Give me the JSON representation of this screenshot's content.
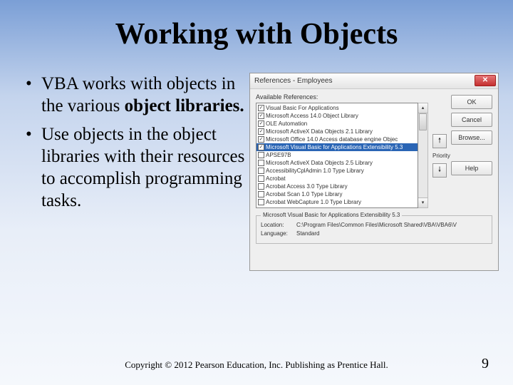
{
  "title": "Working with Objects",
  "bullets": [
    {
      "pre": "VBA works with objects in the various ",
      "bold": "object libraries."
    },
    {
      "pre": "Use objects in the object libraries with their resources to accomplish programming tasks.",
      "bold": ""
    }
  ],
  "dialog": {
    "title": "References - Employees",
    "available_label": "Available References:",
    "items": [
      {
        "checked": true,
        "label": "Visual Basic For Applications"
      },
      {
        "checked": true,
        "label": "Microsoft Access 14.0 Object Library"
      },
      {
        "checked": true,
        "label": "OLE Automation"
      },
      {
        "checked": true,
        "label": "Microsoft ActiveX Data Objects 2.1 Library"
      },
      {
        "checked": true,
        "label": "Microsoft Office 14.0 Access database engine Objec"
      },
      {
        "checked": true,
        "label": "Microsoft Visual Basic for Applications Extensibility 5.3",
        "selected": true
      },
      {
        "checked": false,
        "label": "APSE97B"
      },
      {
        "checked": false,
        "label": "Microsoft ActiveX Data Objects 2.5 Library"
      },
      {
        "checked": false,
        "label": "AccessibilityCplAdmin 1.0 Type Library"
      },
      {
        "checked": false,
        "label": "Acrobat"
      },
      {
        "checked": false,
        "label": "Acrobat Access 3.0 Type Library"
      },
      {
        "checked": false,
        "label": "Acrobat Scan 1.0 Type Library"
      },
      {
        "checked": false,
        "label": "Acrobat WebCapture 1.0 Type Library"
      }
    ],
    "priority_label": "Priority",
    "buttons": {
      "ok": "OK",
      "cancel": "Cancel",
      "browse": "Browse...",
      "help": "Help"
    },
    "detail": {
      "legend": "Microsoft Visual Basic for Applications Extensibility 5.3",
      "location_label": "Location:",
      "location_value": "C:\\Program Files\\Common Files\\Microsoft Shared\\VBA\\VBA6\\V",
      "language_label": "Language:",
      "language_value": "Standard"
    }
  },
  "footer": "Copyright © 2012 Pearson Education, Inc. Publishing as Prentice Hall.",
  "page_number": "9"
}
